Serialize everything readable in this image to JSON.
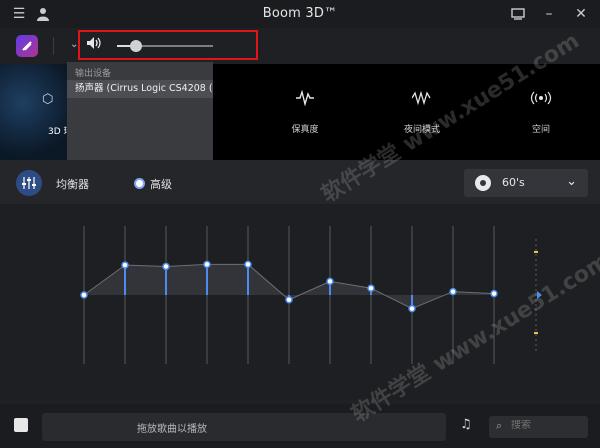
{
  "window": {
    "title": "Boom 3D™"
  },
  "toolbar": {
    "volume_level": 0.2
  },
  "dropdown": {
    "heading": "输出设备",
    "selected_device": "扬声器 (Cirrus Logic CS4208 (..."
  },
  "modes": [
    {
      "label": "3D 环",
      "icon": "3d-cube-icon"
    },
    {
      "label": "保真度",
      "icon": "waveform-icon"
    },
    {
      "label": "夜间模式",
      "icon": "night-wave-icon"
    },
    {
      "label": "空间",
      "icon": "spatial-icon"
    }
  ],
  "equalizer": {
    "label": "均衡器",
    "mode_option": "高级",
    "preset": "60's",
    "bands": [
      0,
      0.44,
      0.42,
      0.45,
      0.45,
      -0.07,
      0.2,
      0.1,
      -0.2,
      0.05,
      0.02
    ],
    "accent_color": "#4a8cf0"
  },
  "bottom": {
    "drop_hint": "拖放歌曲以播放",
    "search_placeholder": "搜索"
  },
  "watermark": "软件学堂 www.xue51.com"
}
